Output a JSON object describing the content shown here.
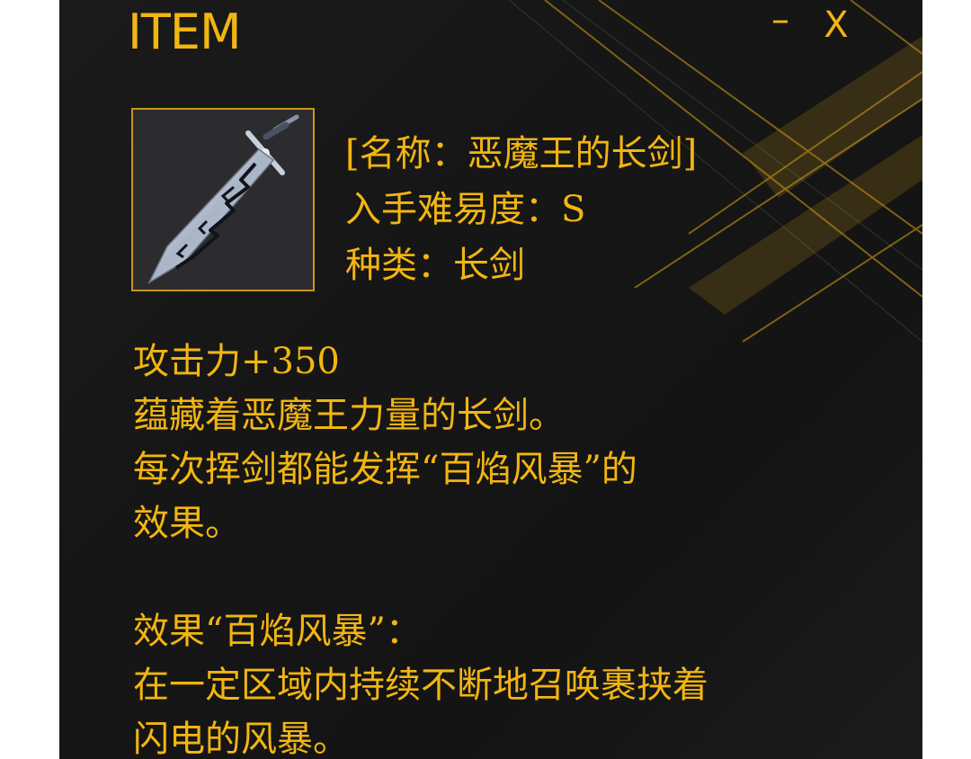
{
  "window": {
    "title": "ITEM",
    "minimize_label": "–",
    "close_label": "X"
  },
  "item": {
    "icon": "demon-king-longsword-icon",
    "name_line": "[名称：恶魔王的长剑]",
    "difficulty_line": "入手难易度：S",
    "type_line": "种类：长剑"
  },
  "description": {
    "attack": "攻击力+350",
    "lines": [
      "蕴藏着恶魔王力量的长剑。",
      "每次挥剑都能发挥“百焰风暴”的",
      "效果。"
    ],
    "effect_title": "效果“百焰风暴”：",
    "effect_lines": [
      "在一定区域内持续不断地召唤裹挟着",
      "闪电的风暴。"
    ]
  },
  "colors": {
    "text": "#f2b511",
    "panel": "#161616",
    "frame_border": "#c9961a",
    "accent_lines": "#d4a017"
  }
}
